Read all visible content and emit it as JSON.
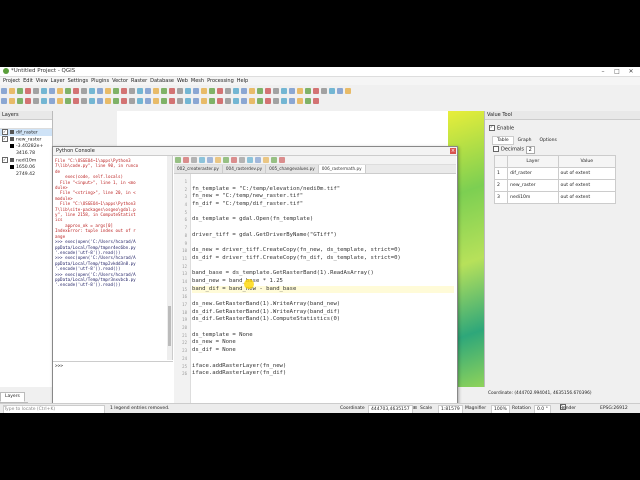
{
  "window": {
    "title": "*Untitled Project - QGIS"
  },
  "menu": [
    "Project",
    "Edit",
    "View",
    "Layer",
    "Settings",
    "Plugins",
    "Vector",
    "Raster",
    "Database",
    "Web",
    "Mesh",
    "Processing",
    "Help"
  ],
  "layers_panel": {
    "title": "Layers",
    "layers": [
      {
        "name": "dif_raster",
        "selected": true
      },
      {
        "name": "new_raster",
        "min": "-3.40282e+",
        "max": "3416.78"
      },
      {
        "name": "nedi10m",
        "min": "1650.06",
        "max": "2749.42"
      }
    ],
    "tabs": [
      "Layers",
      "Browser"
    ]
  },
  "python_console": {
    "title": "Python Console",
    "output": [
      "File \"C:\\OSGEO4~1\\apps\\Python3",
      "7\\lib\\code.py\", line 90, in runco",
      "de",
      "    exec(code, self.locals)",
      "  File \"<input>\", line 1, in <mo",
      "dule>",
      "  File \"<string>\", line 20, in <",
      "module>",
      "  File \"C:\\OSGEO4~1\\apps\\Python3",
      "7\\lib\\site-packages\\osgeo\\gdal.p",
      "y\", line 2158, in ComputeStatist",
      "ics",
      "    approx_ok = args[0]",
      "IndexError: tuple index out of r",
      "ange",
      ">>> exec(open('C:/Users/hcarad/A",
      "ppData/Local/Temp/tmpnr4ec6bn.py",
      "'.encode('utf-8')).read())",
      ">>> exec(open('C:/Users/hcarad/A",
      "ppData/Local/Temp/tmp2vkdd3n8.py",
      "'.encode('utf-8')).read())",
      ">>> exec(open('C:/Users/hcarad/A",
      "ppData/Local/Temp/tmpr3nxvbcb.py",
      "'.encode('utf-8')).read())"
    ],
    "prompt": ">>>",
    "editor_tabs": [
      "002_createraster.py",
      "004_rasterdev.py",
      "005_changevalues.py",
      "006_rastermath.py"
    ],
    "code_lines": [
      {
        "n": "1",
        "text": ""
      },
      {
        "n": "2",
        "text": "fn_template = \"C:/temp/elevation/nedi0m.tif\""
      },
      {
        "n": "3",
        "text": "fn_new = \"C:/temp/new_raster.tif\""
      },
      {
        "n": "4",
        "text": "fn_dif = \"C:/temp/dif_raster.tif\""
      },
      {
        "n": "5",
        "text": ""
      },
      {
        "n": "6",
        "text": "ds_template = gdal.Open(fn_template)"
      },
      {
        "n": "7",
        "text": ""
      },
      {
        "n": "8",
        "text": "driver_tiff = gdal.GetDriverByName(\"GTiff\")"
      },
      {
        "n": "9",
        "text": ""
      },
      {
        "n": "10",
        "text": "ds_new = driver_tiff.CreateCopy(fn_new, ds_template, strict=0)"
      },
      {
        "n": "11",
        "text": "ds_dif = driver_tiff.CreateCopy(fn_dif, ds_template, strict=0)"
      },
      {
        "n": "12",
        "text": ""
      },
      {
        "n": "13",
        "text": "band_base = ds_template.GetRasterBand(1).ReadAsArray()"
      },
      {
        "n": "14",
        "text": "band_new = band_base * 1.25"
      },
      {
        "n": "15",
        "text": "band_dif = band_new - band_base"
      },
      {
        "n": "16",
        "text": ""
      },
      {
        "n": "17",
        "text": "ds_new.GetRasterBand(1).WriteArray(band_new)"
      },
      {
        "n": "18",
        "text": "ds_dif.GetRasterBand(1).WriteArray(band_dif)"
      },
      {
        "n": "19",
        "text": "ds_dif.GetRasterBand(1).ComputeStatistics(0)"
      },
      {
        "n": "20",
        "text": ""
      },
      {
        "n": "21",
        "text": "ds_template = None"
      },
      {
        "n": "22",
        "text": "ds_new = None"
      },
      {
        "n": "23",
        "text": "ds_dif = None"
      },
      {
        "n": "24",
        "text": ""
      },
      {
        "n": "25",
        "text": "iface.addRasterLayer(fn_new)"
      },
      {
        "n": "26",
        "text": "iface.addRasterLayer(fn_dif)"
      }
    ]
  },
  "value_tool": {
    "title": "Value Tool",
    "enable_label": "Enable",
    "tabs": [
      "Table",
      "Graph",
      "Options"
    ],
    "decimals_label": "Decimals",
    "decimals_value": "2",
    "columns": [
      "Layer",
      "Value"
    ],
    "rows": [
      {
        "n": "1",
        "layer": "dif_raster",
        "value": "out of extent"
      },
      {
        "n": "2",
        "layer": "new_raster",
        "value": "out of extent"
      },
      {
        "n": "3",
        "layer": "nedi10m",
        "value": "out of extent"
      }
    ]
  },
  "status": {
    "search_placeholder": "Type to locate (Ctrl+K)",
    "message": "1 legend entries removed.",
    "coordinate_label": "Coordinate",
    "coordinate_value": "444703,4635157",
    "scale_label": "Scale",
    "scale_value": "1:81579",
    "magnifier_label": "Magnifier",
    "magnifier_value": "100%",
    "rotation_label": "Rotation",
    "rotation_value": "0.0 °",
    "render_label": "Render",
    "crs": "EPSG:26912",
    "vt_coordinate": "Coordinate: (444702.994041, 4635156.670396)"
  },
  "colors": {
    "accent": "#5a9e3a",
    "raster_high": "#e8ee3a",
    "raster_low": "#2ea77a"
  }
}
